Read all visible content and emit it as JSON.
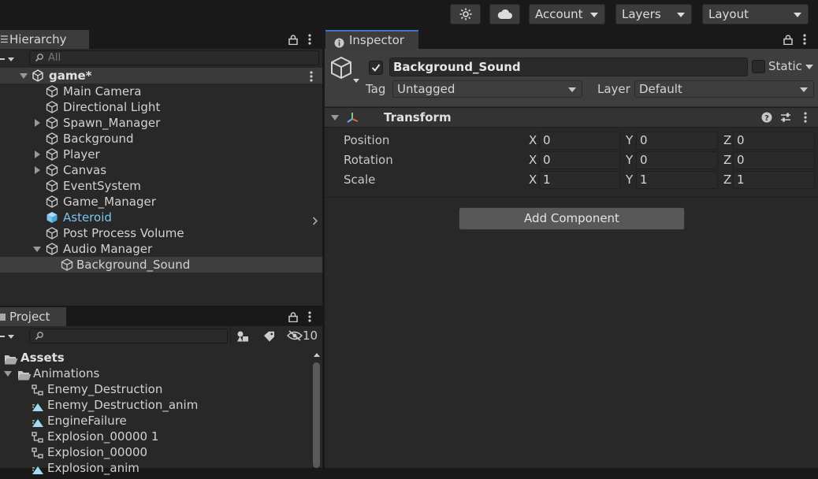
{
  "toolbar": {
    "account_label": "Account",
    "layers_label": "Layers",
    "layout_label": "Layout",
    "icons": [
      "collab-sparkle-icon",
      "cloud-icon"
    ]
  },
  "hierarchy": {
    "tab_label": "Hierarchy",
    "search_placeholder": "All",
    "scene_name": "game*",
    "items": [
      {
        "label": "Main Camera"
      },
      {
        "label": "Directional Light"
      },
      {
        "label": "Spawn_Manager"
      },
      {
        "label": "Background"
      },
      {
        "label": "Player"
      },
      {
        "label": "Canvas"
      },
      {
        "label": "EventSystem"
      },
      {
        "label": "Game_Manager"
      },
      {
        "label": "Asteroid"
      },
      {
        "label": "Post Process Volume"
      },
      {
        "label": "Audio Manager"
      },
      {
        "label": "Background_Sound"
      }
    ]
  },
  "project": {
    "tab_label": "Project",
    "hidden_count": "10",
    "items": [
      {
        "label": "Assets"
      },
      {
        "label": "Animations"
      },
      {
        "label": "Enemy_Destruction"
      },
      {
        "label": "Enemy_Destruction_anim"
      },
      {
        "label": "EngineFailure"
      },
      {
        "label": "Explosion_00000 1"
      },
      {
        "label": "Explosion_00000"
      },
      {
        "label": "Explosion_anim"
      }
    ]
  },
  "inspector": {
    "tab_label": "Inspector",
    "object_name": "Background_Sound",
    "static_label": "Static",
    "tag_label": "Tag",
    "tag_value": "Untagged",
    "layer_label": "Layer",
    "layer_value": "Default",
    "component_title": "Transform",
    "axis": {
      "x": "X",
      "y": "Y",
      "z": "Z"
    },
    "position": {
      "label": "Position",
      "x": "0",
      "y": "0",
      "z": "0"
    },
    "rotation": {
      "label": "Rotation",
      "x": "0",
      "y": "0",
      "z": "0"
    },
    "scale": {
      "label": "Scale",
      "x": "1",
      "y": "1",
      "z": "1"
    },
    "add_component_label": "Add Component"
  },
  "colors": {
    "accent": "#3a79bb",
    "prefab_blue": "#7cc4ee",
    "selection": "#3e3e3e"
  }
}
